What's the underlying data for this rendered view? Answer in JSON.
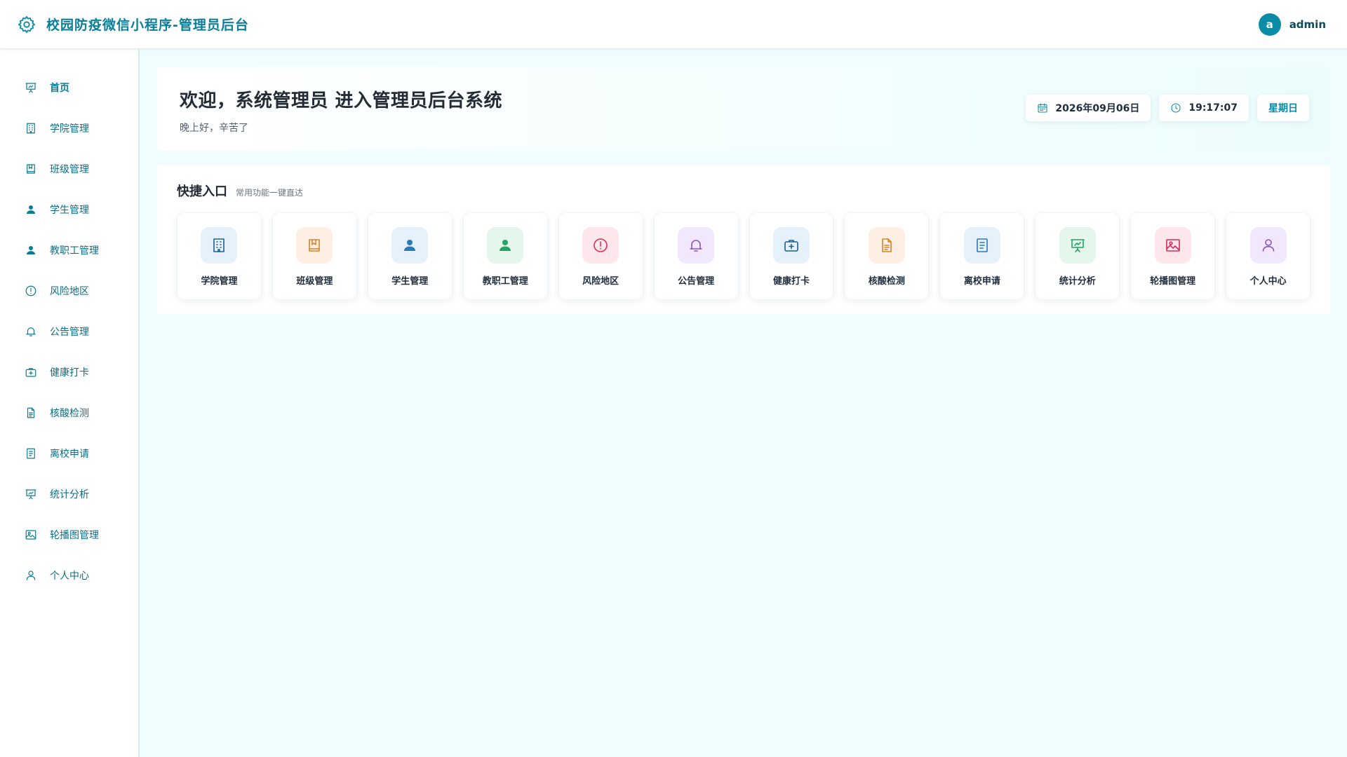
{
  "header": {
    "title": "校园防疫微信小程序-管理员后台",
    "avatar_letter": "a",
    "username": "admin"
  },
  "sidebar": {
    "items": [
      {
        "label": "首页",
        "icon": "presentation-chart-icon",
        "active": true
      },
      {
        "label": "学院管理",
        "icon": "building-icon"
      },
      {
        "label": "班级管理",
        "icon": "bookmark-book-icon"
      },
      {
        "label": "学生管理",
        "icon": "user-filled-icon"
      },
      {
        "label": "教职工管理",
        "icon": "user-filled-icon"
      },
      {
        "label": "风险地区",
        "icon": "alert-circle-icon"
      },
      {
        "label": "公告管理",
        "icon": "bell-icon"
      },
      {
        "label": "健康打卡",
        "icon": "medical-kit-icon"
      },
      {
        "label": "核酸检测",
        "icon": "document-icon"
      },
      {
        "label": "离校申请",
        "icon": "notepad-icon"
      },
      {
        "label": "统计分析",
        "icon": "presentation-chart-icon"
      },
      {
        "label": "轮播图管理",
        "icon": "image-icon"
      },
      {
        "label": "个人中心",
        "icon": "user-outline-icon"
      }
    ]
  },
  "welcome": {
    "title": "欢迎，系统管理员 进入管理员后台系统",
    "subtitle": "晚上好，辛苦了",
    "date": "2026年09月06日",
    "time": "19:17:07",
    "weekday": "星期日"
  },
  "quick": {
    "title": "快捷入口",
    "hint": "常用功能一键直达",
    "cards": [
      {
        "label": "学院管理",
        "icon": "building-icon",
        "bg": "#e6f2fb",
        "color": "#1c5f8f"
      },
      {
        "label": "班级管理",
        "icon": "bookmark-book-icon",
        "bg": "#fdf0e2",
        "color": "#d9822b"
      },
      {
        "label": "学生管理",
        "icon": "user-filled-icon",
        "bg": "#e6f2fb",
        "color": "#2b78b5"
      },
      {
        "label": "教职工管理",
        "icon": "user-filled-icon",
        "bg": "#e5f6ec",
        "color": "#27a363"
      },
      {
        "label": "风险地区",
        "icon": "alert-circle-icon",
        "bg": "#fde6ec",
        "color": "#d92c57"
      },
      {
        "label": "公告管理",
        "icon": "bell-icon",
        "bg": "#f2e8fb",
        "color": "#8e4fc2"
      },
      {
        "label": "健康打卡",
        "icon": "medical-kit-icon",
        "bg": "#e6f2fb",
        "color": "#1c5f8f"
      },
      {
        "label": "核酸检测",
        "icon": "document-icon",
        "bg": "#fdf0e2",
        "color": "#d9822b"
      },
      {
        "label": "离校申请",
        "icon": "notepad-icon",
        "bg": "#e6f2fb",
        "color": "#2b78b5"
      },
      {
        "label": "统计分析",
        "icon": "presentation-chart-icon",
        "bg": "#e5f6ec",
        "color": "#27a363"
      },
      {
        "label": "轮播图管理",
        "icon": "image-icon",
        "bg": "#fde6ec",
        "color": "#d92c57"
      },
      {
        "label": "个人中心",
        "icon": "user-outline-icon",
        "bg": "#f2e8fb",
        "color": "#8e4fc2"
      }
    ]
  },
  "colors": {
    "accent": "#0b8ca6",
    "background": "#f0fdfe"
  }
}
